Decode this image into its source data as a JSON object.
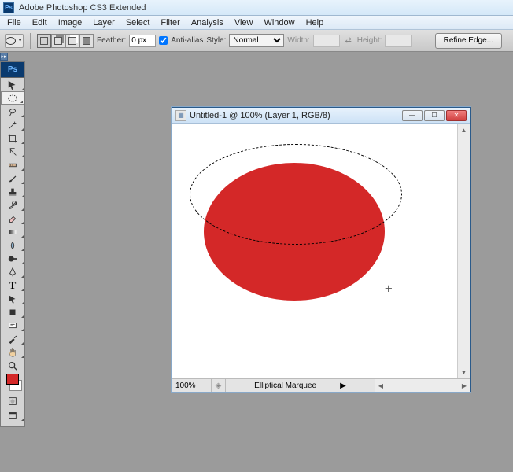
{
  "app": {
    "title": "Adobe Photoshop CS3 Extended",
    "logo": "Ps"
  },
  "menu": [
    "File",
    "Edit",
    "Image",
    "Layer",
    "Select",
    "Filter",
    "Analysis",
    "View",
    "Window",
    "Help"
  ],
  "options": {
    "feather_label": "Feather:",
    "feather_value": "0 px",
    "antialias_label": "Anti-alias",
    "antialias_checked": true,
    "style_label": "Style:",
    "style_value": "Normal",
    "width_label": "Width:",
    "width_value": "",
    "height_label": "Height:",
    "height_value": "",
    "refine": "Refine Edge..."
  },
  "tools_header": "Ps",
  "fg_color": "#d42828",
  "bg_color": "#ffffff",
  "document": {
    "title": "Untitled-1 @ 100% (Layer 1, RGB/8)",
    "zoom": "100%",
    "status_info": "Elliptical Marquee"
  }
}
